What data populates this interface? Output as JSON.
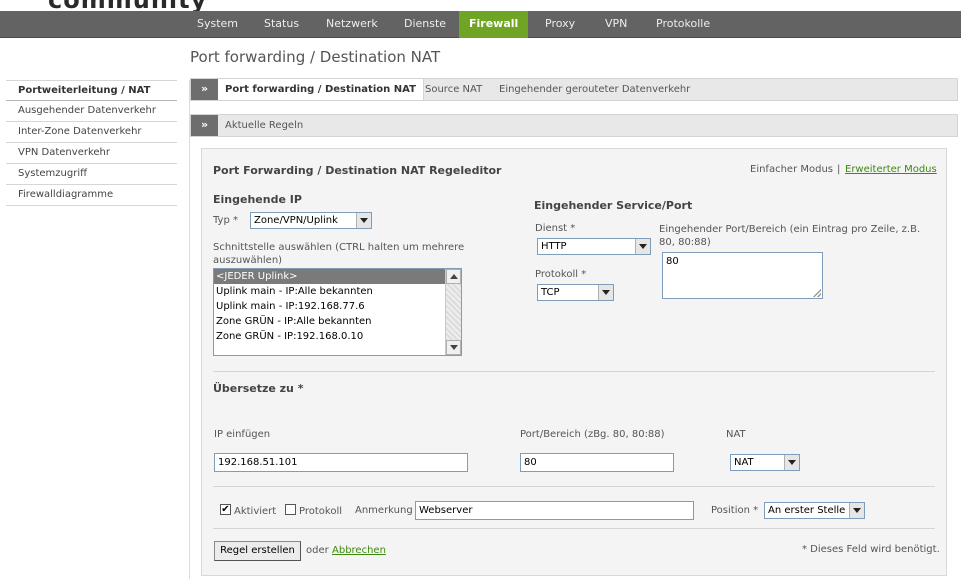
{
  "logo": {
    "text_part1": "",
    "text_part2": "community"
  },
  "topnav": {
    "items": [
      "System",
      "Status",
      "Netzwerk",
      "Dienste",
      "Firewall",
      "Proxy",
      "VPN",
      "Protokolle"
    ]
  },
  "page_title": "Port forwarding / Destination NAT",
  "leftnav": {
    "items": [
      "Portweiterleitung / NAT",
      "Ausgehender Datenverkehr",
      "Inter-Zone Datenverkehr",
      "VPN Datenverkehr",
      "Systemzugriff",
      "Firewalldiagramme"
    ]
  },
  "tabs": {
    "arrow": "»",
    "items": [
      "Port forwarding / Destination NAT",
      "Source NAT",
      "Eingehender gerouteter Datenverkehr"
    ]
  },
  "section": {
    "arrow": "»",
    "label": "Aktuelle Regeln"
  },
  "editor": {
    "title": "Port Forwarding / Destination NAT Regeleditor",
    "mode_simple": "Einfacher Modus",
    "mode_separator": "|",
    "mode_advanced": "Erweiterter Modus",
    "incoming_ip": {
      "heading": "Eingehende IP",
      "type_label": "Typ *",
      "type_value": "Zone/VPN/Uplink",
      "interface_label": "Schnittstelle auswählen (CTRL halten um mehrere auszuwählen)",
      "interfaces": [
        "<JEDER Uplink>",
        "Uplink main - IP:Alle bekannten",
        "Uplink main - IP:192.168.77.6",
        "Zone GRÜN - IP:Alle bekannten",
        "Zone GRÜN - IP:192.168.0.10"
      ]
    },
    "incoming_service": {
      "heading": "Eingehender Service/Port",
      "service_label": "Dienst *",
      "service_value": "HTTP",
      "protocol_label": "Protokoll *",
      "protocol_value": "TCP",
      "port_label": "Eingehender Port/Bereich (ein Eintrag pro Zeile, z.B. 80, 80:88)",
      "port_value": "80"
    },
    "translate": {
      "heading": "Übersetze zu *",
      "ip_label": "IP einfügen",
      "ip_value": "192.168.51.101",
      "port_label": "Port/Bereich (zBg. 80, 80:88)",
      "port_value": "80",
      "nat_label": "NAT",
      "nat_value": "NAT"
    },
    "options": {
      "enabled_label": "Aktiviert",
      "enabled_mark": "✔",
      "log_label": "Protokoll",
      "remark_label": "Anmerkung",
      "remark_value": "Webserver",
      "position_label": "Position *",
      "position_value": "An erster Stelle"
    },
    "footer": {
      "create_button": "Regel erstellen",
      "or_text": "oder",
      "cancel_link": "Abbrechen",
      "required_note": "* Dieses Feld wird benötigt."
    }
  }
}
